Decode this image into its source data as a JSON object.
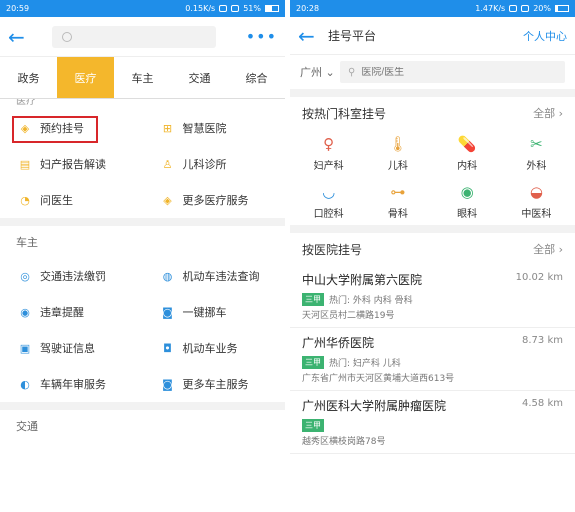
{
  "left": {
    "status": {
      "time": "20:59",
      "speed": "0.15K/s",
      "battery": "51%",
      "battery_level": 0.51
    },
    "tabs": [
      "政务",
      "医疗",
      "车主",
      "交通",
      "综合"
    ],
    "active_tab": 1,
    "section_cut_label": "医疗",
    "medical_items": [
      {
        "label": "预约挂号",
        "icon": "diamond-icon"
      },
      {
        "label": "智慧医院",
        "icon": "hospital-icon"
      },
      {
        "label": "妇产报告解读",
        "icon": "report-icon"
      },
      {
        "label": "儿科诊所",
        "icon": "child-icon"
      },
      {
        "label": "问医生",
        "icon": "chat-icon"
      },
      {
        "label": "更多医疗服务",
        "icon": "diamond-icon"
      }
    ],
    "car_section_title": "车主",
    "car_items": [
      {
        "label": "交通违法缴罚",
        "icon": "fine-icon"
      },
      {
        "label": "机动车违法查询",
        "icon": "car-query-icon"
      },
      {
        "label": "违章提醒",
        "icon": "alert-icon"
      },
      {
        "label": "一键挪车",
        "icon": "car-icon"
      },
      {
        "label": "驾驶证信息",
        "icon": "license-icon"
      },
      {
        "label": "机动车业务",
        "icon": "car-service-icon"
      },
      {
        "label": "车辆年审服务",
        "icon": "inspection-icon"
      },
      {
        "label": "更多车主服务",
        "icon": "car-more-icon"
      }
    ],
    "traffic_section_title": "交通"
  },
  "right": {
    "status": {
      "time": "20:28",
      "speed": "1.47K/s",
      "battery": "20%",
      "battery_level": 0.2
    },
    "title": "挂号平台",
    "personal": "个人中心",
    "city": "广州",
    "search_placeholder": "医院/医生",
    "hot_dept_title": "按热门科室挂号",
    "all_label": "全部",
    "departments": [
      {
        "label": "妇产科",
        "icon": "uterus-icon",
        "color": "#e0604c"
      },
      {
        "label": "儿科",
        "icon": "thermometer-icon",
        "color": "#e8a23a"
      },
      {
        "label": "内科",
        "icon": "pill-icon",
        "color": "#2d8fdb"
      },
      {
        "label": "外科",
        "icon": "scissors-icon",
        "color": "#3cb371"
      },
      {
        "label": "口腔科",
        "icon": "tooth-icon",
        "color": "#2d8fdb"
      },
      {
        "label": "骨科",
        "icon": "bone-icon",
        "color": "#e8a23a"
      },
      {
        "label": "眼科",
        "icon": "eye-icon",
        "color": "#3cb371"
      },
      {
        "label": "中医科",
        "icon": "mortar-icon",
        "color": "#e0604c"
      }
    ],
    "hospital_title": "按医院挂号",
    "hospitals": [
      {
        "name": "中山大学附属第六医院",
        "distance": "10.02 km",
        "badge": "三甲",
        "hot": "热门: 外科 内科 骨科",
        "address": "天河区员村二横路19号"
      },
      {
        "name": "广州华侨医院",
        "distance": "8.73 km",
        "badge": "三甲",
        "hot": "热门: 妇产科 儿科",
        "address": "广东省广州市天河区黄埔大道西613号"
      },
      {
        "name": "广州医科大学附属肿瘤医院",
        "distance": "4.58 km",
        "badge": "三甲",
        "hot": "",
        "address": "越秀区横枝岗路78号"
      }
    ]
  }
}
